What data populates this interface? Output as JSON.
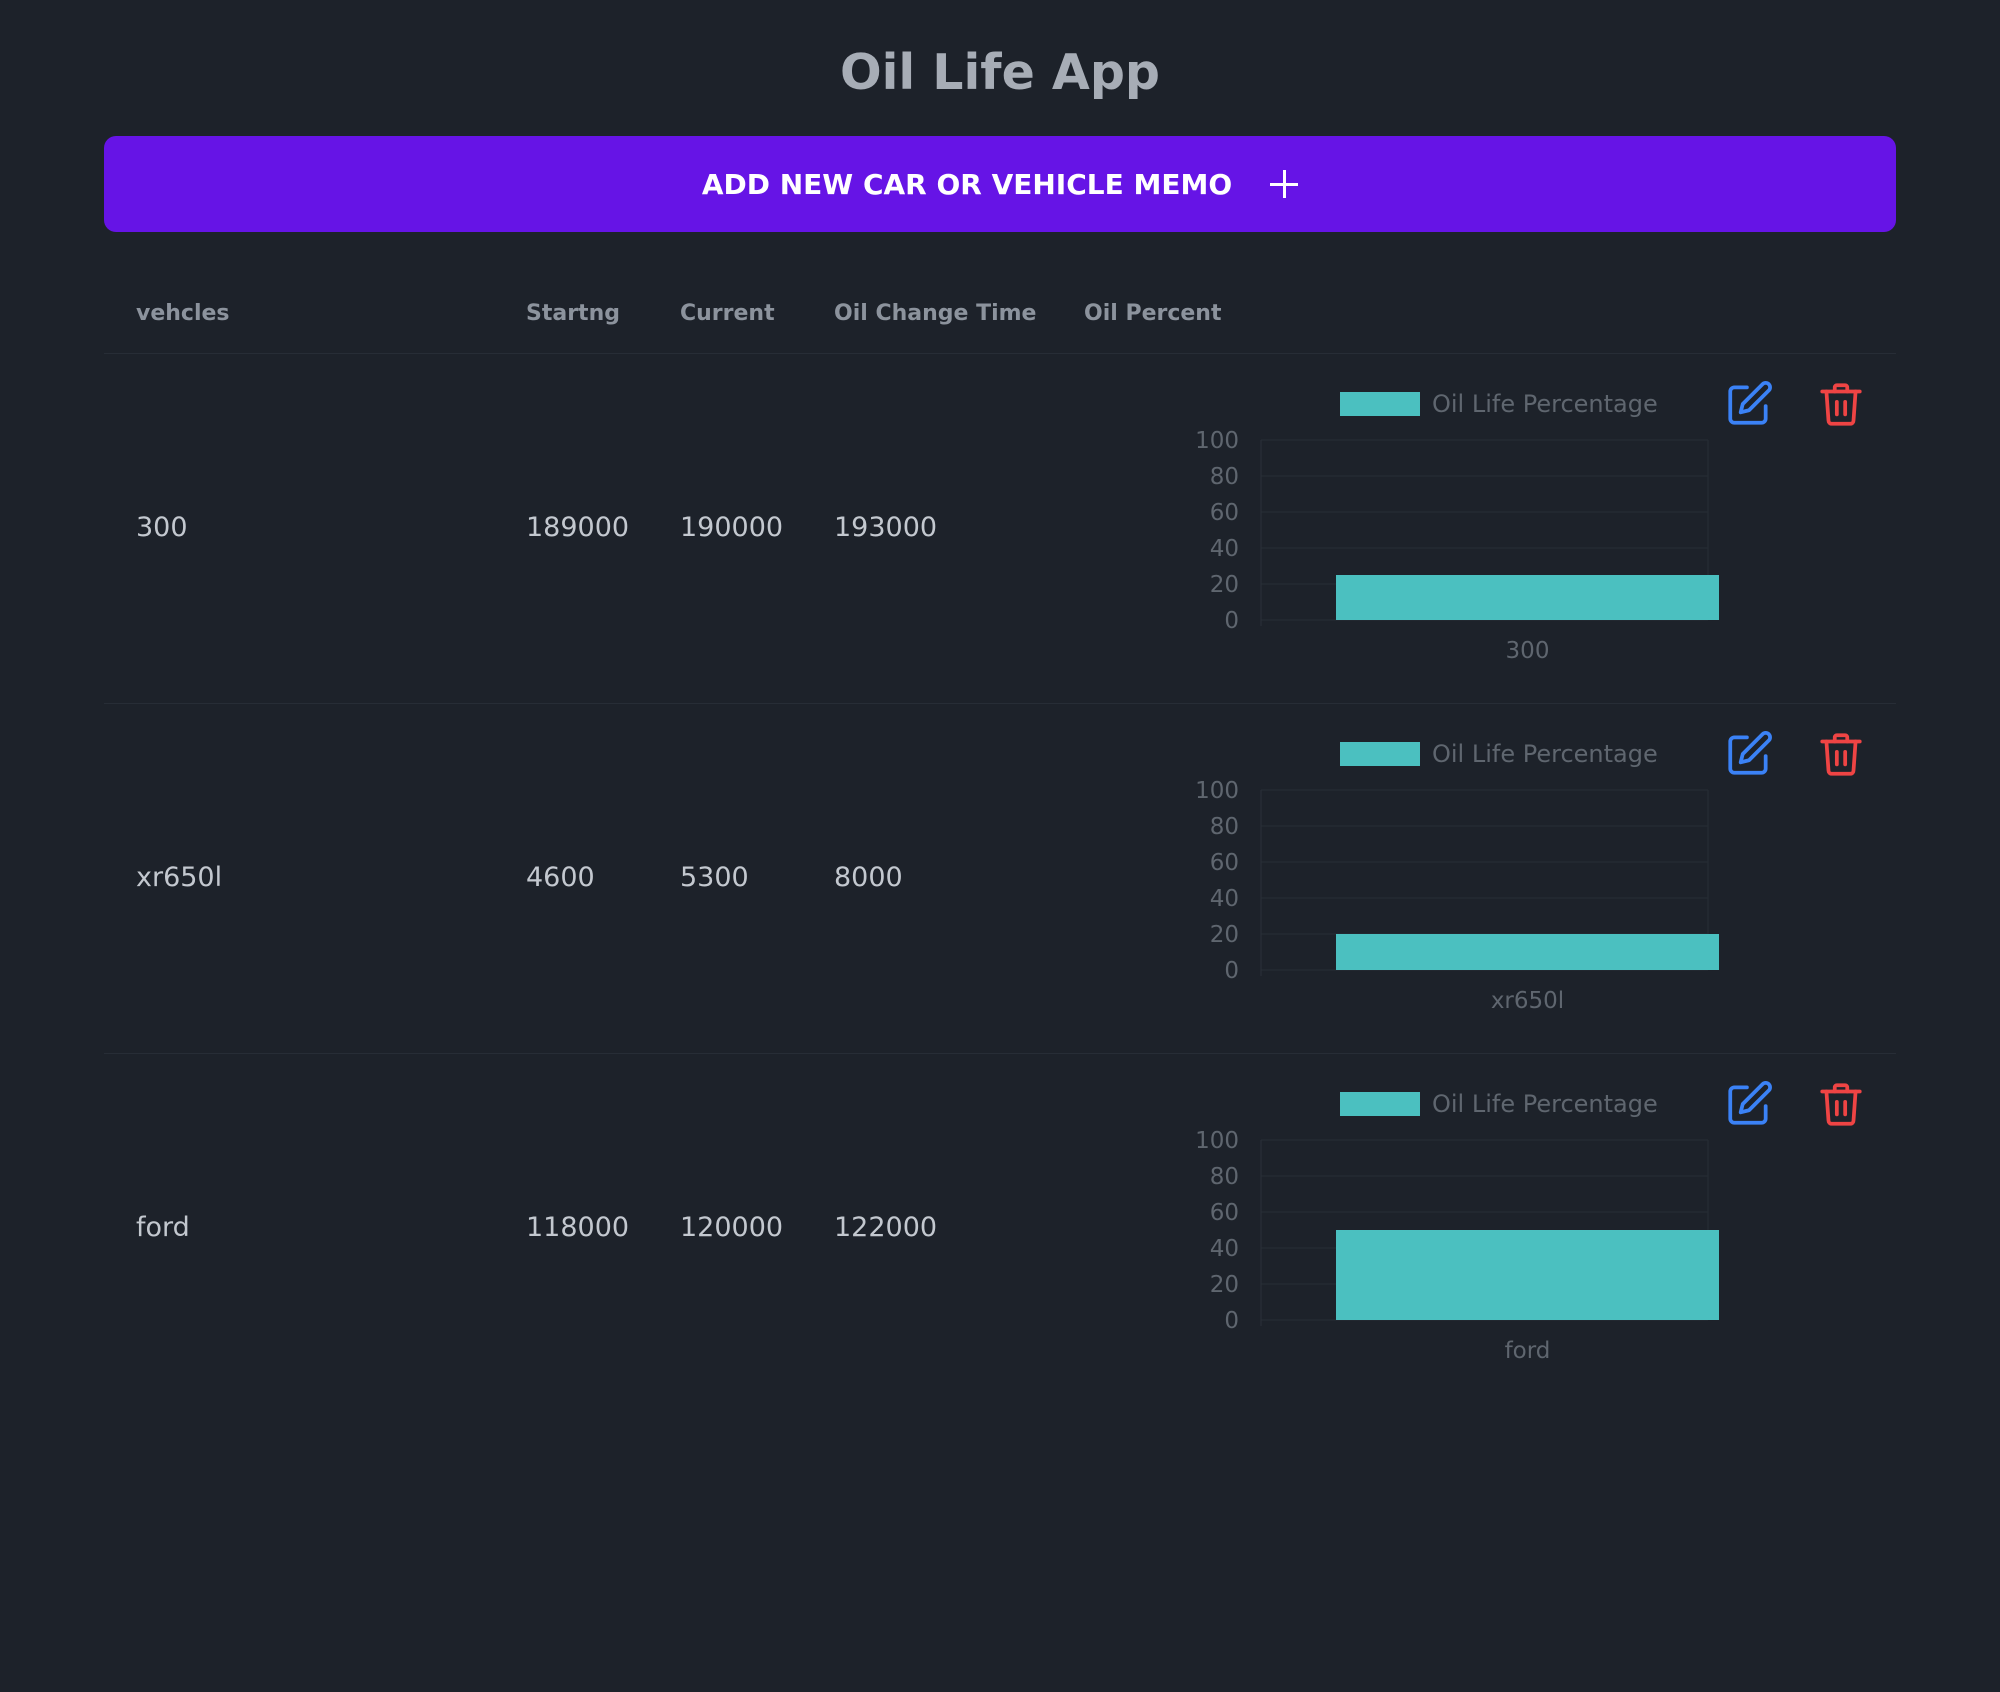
{
  "app": {
    "title": "Oil Life App"
  },
  "add_button": {
    "label": "ADD NEW CAR OR VEHICLE MEMO"
  },
  "table": {
    "headers": [
      "vehcles",
      "Startng",
      "Current",
      "Oil Change Time",
      "Oil Percent"
    ],
    "rows": [
      {
        "vehicle": "300",
        "starting": "189000",
        "current": "190000",
        "oil_change_time": "193000"
      },
      {
        "vehicle": "xr650l",
        "starting": "4600",
        "current": "5300",
        "oil_change_time": "8000"
      },
      {
        "vehicle": "ford",
        "starting": "118000",
        "current": "120000",
        "oil_change_time": "122000"
      }
    ]
  },
  "chart_data": [
    {
      "type": "bar",
      "categories": [
        "300"
      ],
      "series": [
        {
          "name": "Oil Life Percentage",
          "values": [
            25
          ],
          "color": "#4bc0c0"
        }
      ],
      "ylim": [
        0,
        100
      ],
      "yticks": [
        100,
        80,
        60,
        40,
        20,
        0
      ]
    },
    {
      "type": "bar",
      "categories": [
        "xr650l"
      ],
      "series": [
        {
          "name": "Oil Life Percentage",
          "values": [
            20
          ],
          "color": "#4bc0c0"
        }
      ],
      "ylim": [
        0,
        100
      ],
      "yticks": [
        100,
        80,
        60,
        40,
        20,
        0
      ]
    },
    {
      "type": "bar",
      "categories": [
        "ford"
      ],
      "series": [
        {
          "name": "Oil Life Percentage",
          "values": [
            50
          ],
          "color": "#4bc0c0"
        }
      ],
      "ylim": [
        0,
        100
      ],
      "yticks": [
        100,
        80,
        60,
        40,
        20,
        0
      ]
    }
  ],
  "icons": {
    "edit": {
      "name": "edit-icon",
      "color": "#3b82f6"
    },
    "delete": {
      "name": "trash-icon",
      "color": "#ef4444"
    }
  },
  "colors": {
    "background": "#1d222a",
    "accent": "#6614e6",
    "bar": "#4bc0c0"
  }
}
